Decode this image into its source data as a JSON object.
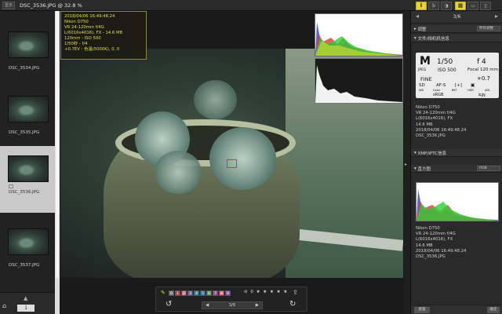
{
  "topbar": {
    "badge_label": "显示",
    "file_title": "DSC_3536.JPG @ 32.8 %",
    "mode_buttons": [
      "i",
      "b",
      "◑"
    ],
    "view_buttons": [
      "▦",
      "▭",
      "▯",
      "≡"
    ]
  },
  "thumbnails": [
    {
      "name": "DSC_3534.JPG",
      "selected": false
    },
    {
      "name": "DSC_3535.JPG",
      "selected": false
    },
    {
      "name": "DSC_3536.JPG",
      "selected": true
    },
    {
      "name": "DSC_3537.JPG",
      "selected": false
    }
  ],
  "strip_bottom": {
    "counter": "1",
    "up_arrow": "▲"
  },
  "info_overlay": [
    "2018/04/06 16:49:48.24",
    "Nikon D750",
    "VR 24-120mm f/4G",
    "L(6016x4016), FX - 14.6 MB",
    "120mm - ISO 500",
    "1/50秒 - f/4",
    "+0.7EV - 色温(5000K), 0, 0"
  ],
  "toolbar": {
    "label_numbers": [
      "0",
      "1",
      "2",
      "3",
      "4",
      "5",
      "6",
      "7",
      "8",
      "9"
    ],
    "label_colors": [
      "#777",
      "#b04a56",
      "#c27a8a",
      "#6e6a9c",
      "#3a8a8e",
      "#3f6fb3",
      "#5a9b4d",
      "#a54aa8",
      "#d06c6c",
      "#8a5ab0"
    ],
    "rating": "⊘ 0 ★ ★ ★ ★ ★",
    "pager": "3/6",
    "pager_prev": "◀",
    "pager_next": "▶"
  },
  "panel": {
    "nav_counter": "3/6",
    "adjust_title": "调整",
    "adjust_select": "所有调整",
    "info_title": "文件/相机机信息",
    "camera_card": {
      "mode": "M",
      "shutter": "1/50",
      "aperture": "f 4",
      "quality": "JPEG",
      "iso": "ISO 500",
      "focal": "Focal 120 mm",
      "fine": "FINE",
      "exp_comp": "+0.7",
      "row_labels": [
        "SD",
        "AF-S",
        "[+]",
        "▣"
      ],
      "row_captions": [
        "WB",
        "Color",
        "BKT",
        "HDR",
        "ADL"
      ],
      "bottom": [
        "sRGB",
        "叫N"
      ]
    },
    "cam_text": [
      "Nikon D750",
      "VR 24-120mm f/4G",
      "L(6016x4016), FX",
      "14.6 MB",
      "2018/04/06 16:49:48.24",
      "DSC_3536.JPG"
    ],
    "xmp_title": "XMP/IPTC信息",
    "hist_title": "直方图",
    "hist_select": "RGB",
    "hist_text": [
      "Nikon D750",
      "VR 24-120mm f/4G",
      "L(6016x4016), FX",
      "14.6 MB",
      "2018/04/06 16:49:48.24",
      "DSC_3536.JPG"
    ],
    "reset_label": "重置",
    "ok_label": "确定"
  }
}
